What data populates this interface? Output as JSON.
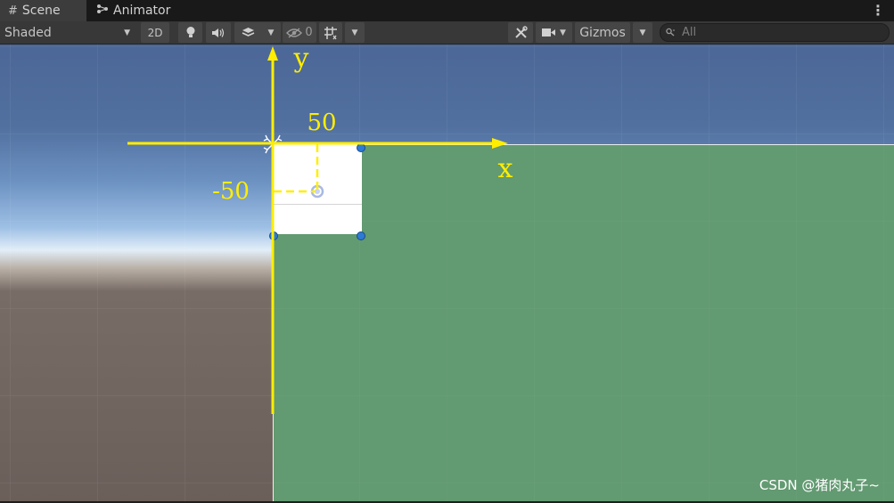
{
  "tabs": [
    {
      "label": "Scene",
      "icon": "grid-icon"
    },
    {
      "label": "Animator",
      "icon": "animator-icon"
    }
  ],
  "toolbar": {
    "draw_mode": "Shaded",
    "mode_2d": "2D",
    "hidden_count": "0",
    "gizmos_label": "Gizmos",
    "search_placeholder": "All"
  },
  "scene": {
    "axis_y_label": "y",
    "axis_x_label": "x",
    "offset_x_label": "50",
    "offset_y_label": "-50",
    "colors": {
      "sky": "#4f6f9e",
      "horizon": "#d8e6f4",
      "ground": "#6a5e59",
      "panel": "#629a71",
      "axis": "#ffee00",
      "rect": "#ffffff"
    }
  },
  "watermark": "CSDN @猪肉丸子~"
}
